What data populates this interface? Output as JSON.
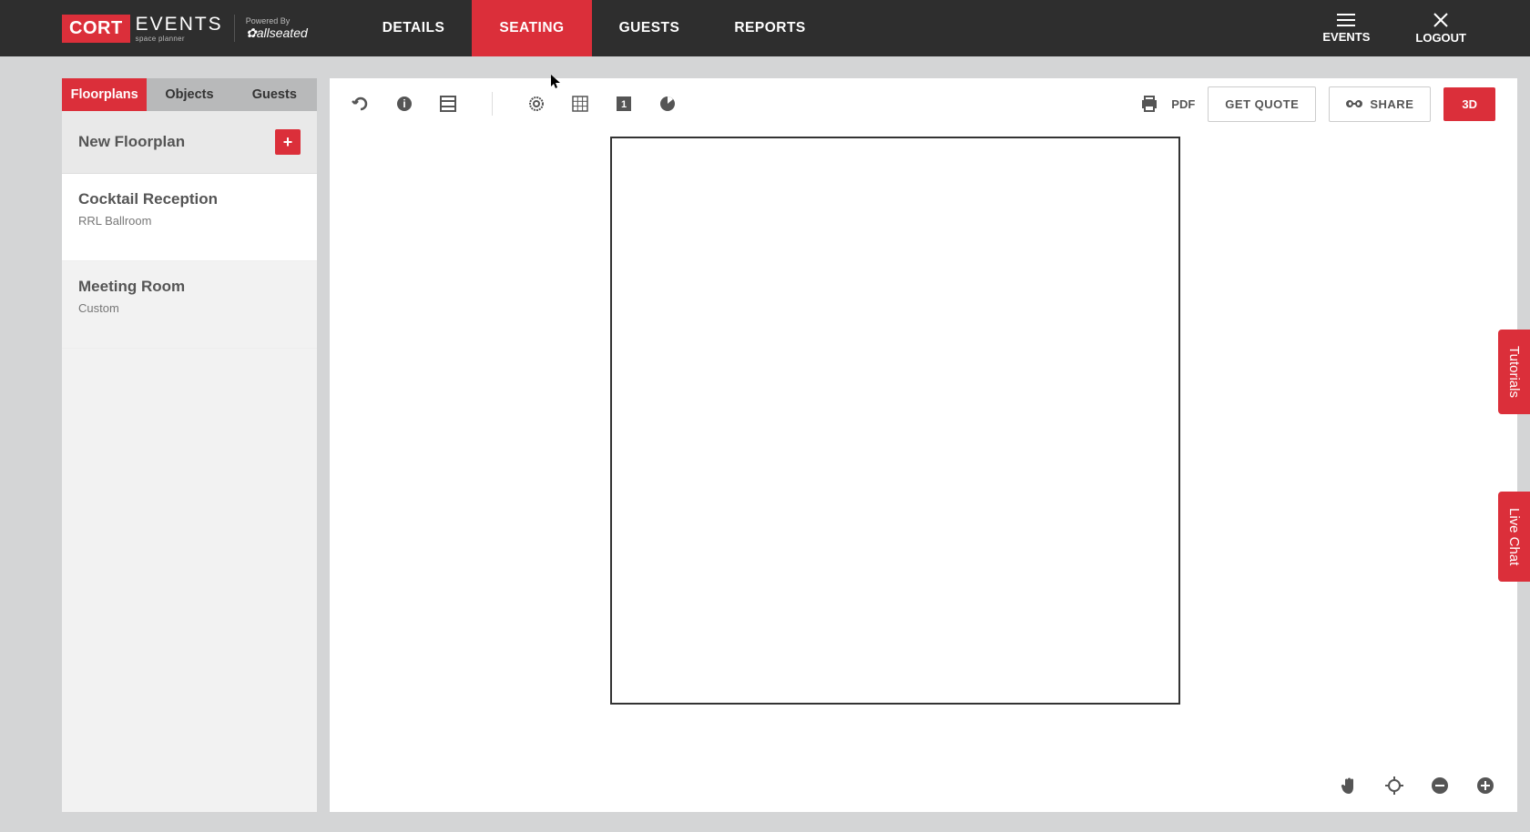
{
  "logo": {
    "cort": "CORT",
    "events": "EVENTS",
    "spaceplanner": "space planner",
    "poweredBy": "Powered By",
    "allseated": "allseated"
  },
  "nav": {
    "details": "DETAILS",
    "seating": "SEATING",
    "guests": "GUESTS",
    "reports": "REPORTS"
  },
  "topRight": {
    "events": "EVENTS",
    "logout": "LOGOUT"
  },
  "sidebarTabs": {
    "floorplans": "Floorplans",
    "objects": "Objects",
    "guests": "Guests"
  },
  "newFloorplan": "New Floorplan",
  "floorplans": [
    {
      "title": "Cocktail Reception",
      "subtitle": "RRL Ballroom"
    },
    {
      "title": "Meeting Room",
      "subtitle": "Custom"
    }
  ],
  "toolbar": {
    "pdf": "PDF",
    "getQuote": "GET QUOTE",
    "share": "SHARE",
    "threeD": "3D",
    "numberBox": "1"
  },
  "sideTabs": {
    "tutorials": "Tutorials",
    "livechat": "Live Chat"
  }
}
